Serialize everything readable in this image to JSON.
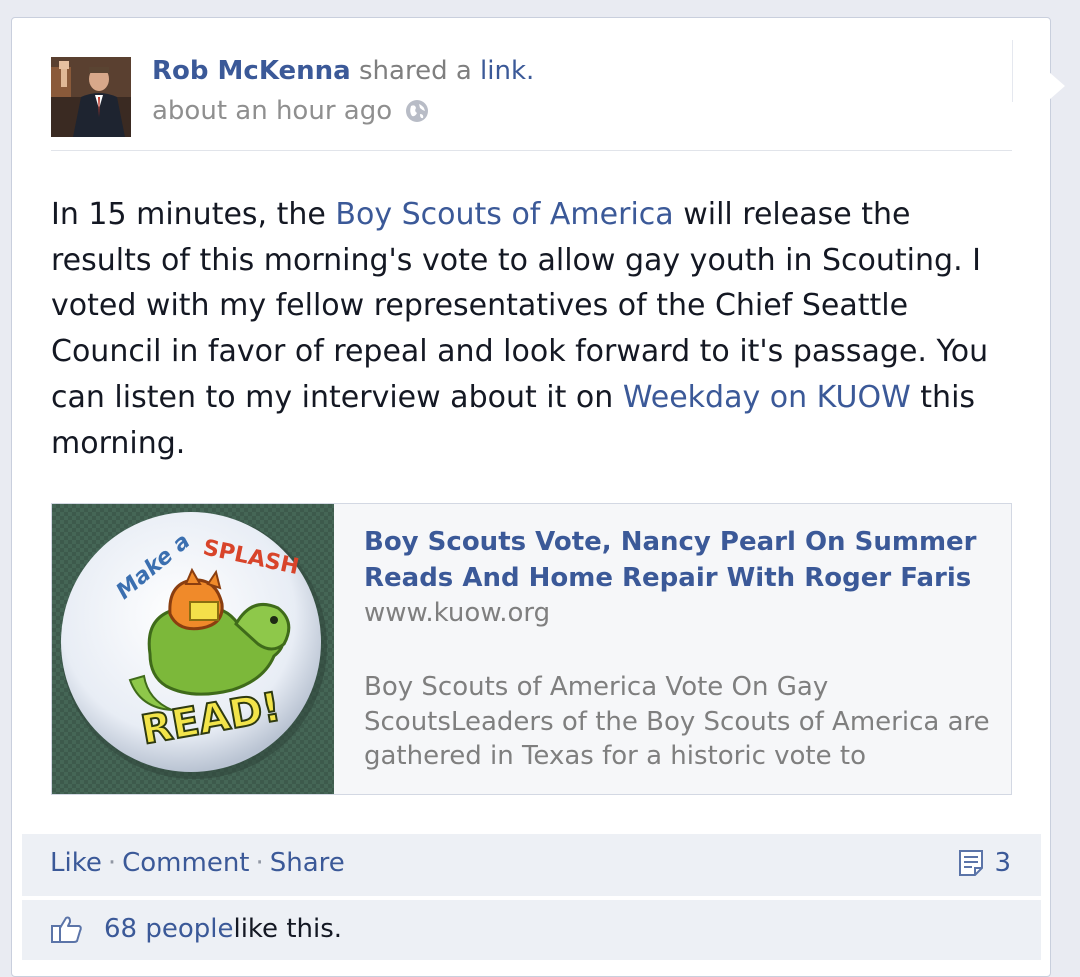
{
  "post": {
    "author": "Rob McKenna",
    "action_text": " shared a ",
    "action_link": "link",
    "action_end": ".",
    "timestamp": "about an hour ago",
    "message": {
      "part1": "In 15 minutes, the ",
      "link1": "Boy Scouts of America",
      "part2": " will release the results of this morning's vote to allow gay youth in Scouting. I voted with my fellow representatives of the Chief Seattle Council in favor of repeal and look forward to it's passage. You can listen to my interview about it on ",
      "link2": "Weekday on KUOW",
      "part3": " this morning."
    },
    "attachment": {
      "title": "Boy Scouts Vote, Nancy Pearl On Summer Reads And Home Repair With Roger Faris",
      "domain": "www.kuow.org",
      "description": "Boy Scouts of America Vote On Gay ScoutsLeaders of the Boy Scouts of America are gathered in Texas for a historic vote to",
      "image": {
        "button_text_top": "Make a SPLASH",
        "button_text_bottom": "READ!"
      }
    }
  },
  "actions": {
    "like": "Like",
    "comment": "Comment",
    "share": "Share",
    "separator": "·",
    "comment_count": "3"
  },
  "likes": {
    "count_text": "68 people",
    "suffix": " like this."
  },
  "icons": {
    "privacy": "globe-icon",
    "comments": "comment-icon",
    "likes": "thumbs-up-icon"
  },
  "colors": {
    "link_blue": "#3b5998",
    "text": "#141823",
    "muted": "#7f7f7f",
    "bar_bg": "#edf0f5"
  }
}
